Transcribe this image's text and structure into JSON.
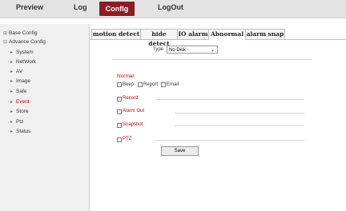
{
  "nav": {
    "preview": "Preview",
    "log": "Log",
    "config": "Config",
    "logout": "LogOut"
  },
  "sidebar": {
    "basic": "Base Config",
    "advance": "Advance Config",
    "items": [
      "System",
      "NetWork",
      "AV",
      "Image",
      "Safe",
      "Event",
      "Store",
      "Ptz",
      "Status"
    ]
  },
  "tabs": [
    "motion detect",
    "hide detect",
    "IO alarm",
    "Abnormal",
    "alarm snap"
  ],
  "form": {
    "type_label": "Type",
    "type_value": "No Disk",
    "section_normal": "Normal",
    "beep": "Beep",
    "report": "Report",
    "email": "Email",
    "record": "Record",
    "alarm_out": "Alarm Out",
    "snapshot": "Snapshot",
    "ptz": "PTZ",
    "save": "Save"
  },
  "colors": {
    "accent": "#8b1e22",
    "label_red": "#cc0000"
  }
}
